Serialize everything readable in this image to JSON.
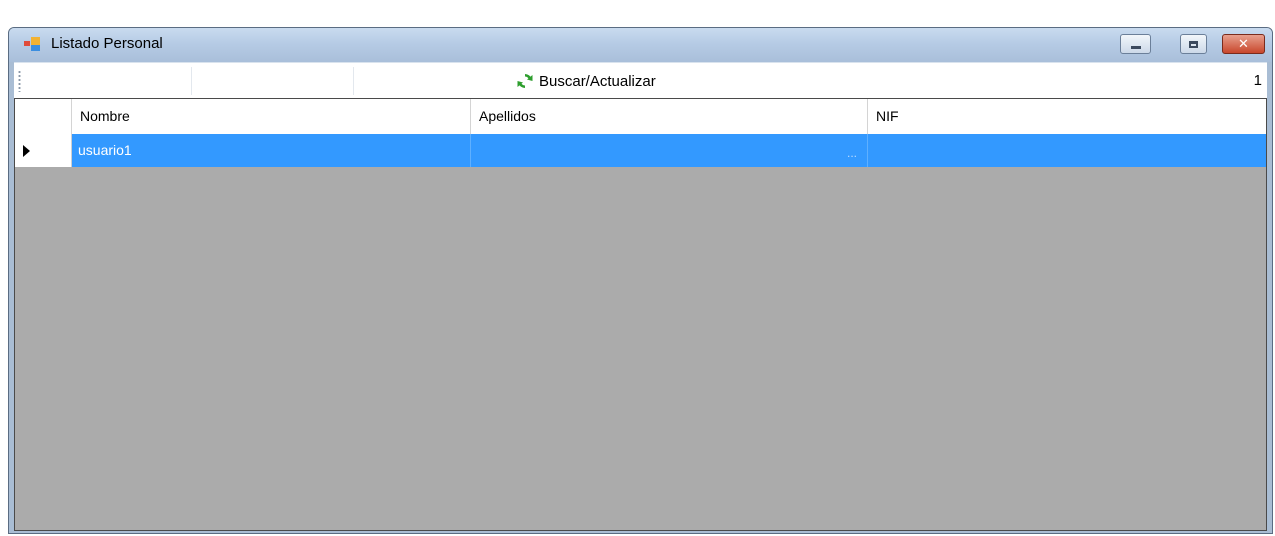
{
  "window": {
    "title": "Listado Personal",
    "controls": {
      "minimize_icon": "minimize-icon",
      "maximize_icon": "maximize-icon",
      "close_icon": "close-icon",
      "close_glyph": "✕"
    }
  },
  "toolbar": {
    "refresh_label": "Buscar/Actualizar",
    "refresh_icon": "refresh-icon",
    "record_count": "1"
  },
  "grid": {
    "columns": [
      "Nombre",
      "Apellidos",
      "NIF"
    ],
    "rows": [
      {
        "nombre": "usuario1",
        "apellidos": "",
        "apellidos_ellipsis": "...",
        "nif": ""
      }
    ],
    "selected_row_color": "#3399ff",
    "background_color": "#ababab"
  }
}
